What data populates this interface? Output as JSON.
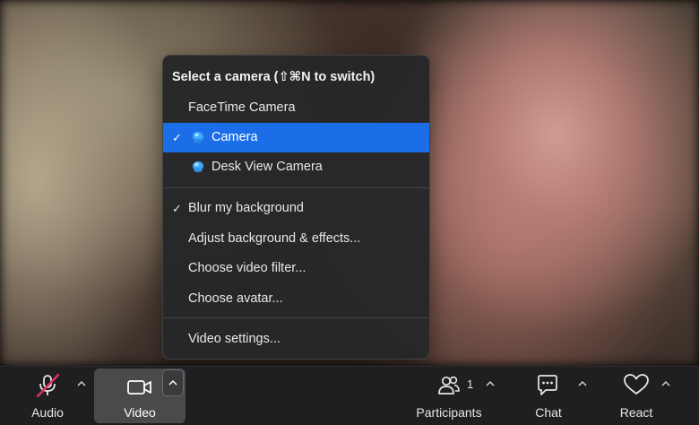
{
  "camera_menu": {
    "title": "Select a camera (⇧⌘N to switch)",
    "items": [
      {
        "label": "FaceTime Camera",
        "checked": false,
        "selected": false,
        "icon": null
      },
      {
        "label": "Camera",
        "checked": true,
        "selected": true,
        "icon": "camera-blob-icon"
      },
      {
        "label": "Desk View Camera",
        "checked": false,
        "selected": false,
        "icon": "camera-blob-icon"
      }
    ],
    "options": [
      {
        "label": "Blur my background",
        "checked": true
      },
      {
        "label": "Adjust background & effects...",
        "checked": false
      },
      {
        "label": "Choose video filter...",
        "checked": false
      },
      {
        "label": "Choose avatar...",
        "checked": false
      }
    ],
    "footer": {
      "label": "Video settings..."
    },
    "check_glyph": "✓",
    "selected_color": "#1c6ee8"
  },
  "toolbar": {
    "audio": {
      "label": "Audio",
      "icon": "microphone-muted-icon",
      "muted": true
    },
    "video": {
      "label": "Video",
      "icon": "video-camera-icon",
      "active": true
    },
    "participants": {
      "label": "Participants",
      "icon": "participants-icon",
      "count": "1"
    },
    "chat": {
      "label": "Chat",
      "icon": "chat-icon"
    },
    "react": {
      "label": "React",
      "icon": "heart-icon"
    },
    "mute_color": "#e0325f"
  }
}
